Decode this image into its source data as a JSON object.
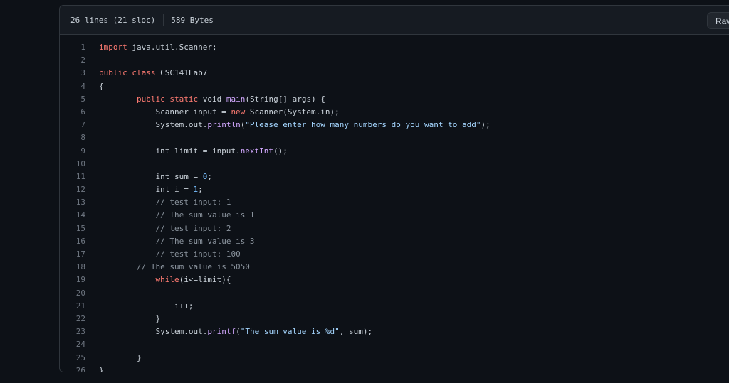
{
  "file_header": {
    "lines_info": "26 lines (21 sloc)",
    "size_info": "589 Bytes",
    "raw_label": "Raw"
  },
  "code_lines": [
    {
      "num": "1",
      "tokens": [
        {
          "t": "import",
          "c": "kw"
        },
        {
          "t": " java.util.Scanner;"
        }
      ]
    },
    {
      "num": "2",
      "tokens": []
    },
    {
      "num": "3",
      "tokens": [
        {
          "t": "public",
          "c": "kw"
        },
        {
          "t": " "
        },
        {
          "t": "class",
          "c": "kw"
        },
        {
          "t": " CSC141Lab7"
        }
      ]
    },
    {
      "num": "4",
      "tokens": [
        {
          "t": "{"
        }
      ]
    },
    {
      "num": "5",
      "tokens": [
        {
          "t": "        "
        },
        {
          "t": "public",
          "c": "kw"
        },
        {
          "t": " "
        },
        {
          "t": "static",
          "c": "kw"
        },
        {
          "t": " void "
        },
        {
          "t": "main",
          "c": "fn"
        },
        {
          "t": "(String[] args) {"
        }
      ]
    },
    {
      "num": "6",
      "tokens": [
        {
          "t": "            Scanner input = "
        },
        {
          "t": "new",
          "c": "kw"
        },
        {
          "t": " Scanner(System.in);"
        }
      ]
    },
    {
      "num": "7",
      "tokens": [
        {
          "t": "            System.out."
        },
        {
          "t": "println",
          "c": "fn"
        },
        {
          "t": "("
        },
        {
          "t": "\"Please enter how many numbers do you want to add\"",
          "c": "str"
        },
        {
          "t": ");"
        }
      ]
    },
    {
      "num": "8",
      "tokens": []
    },
    {
      "num": "9",
      "tokens": [
        {
          "t": "            int limit = input."
        },
        {
          "t": "nextInt",
          "c": "fn"
        },
        {
          "t": "();"
        }
      ]
    },
    {
      "num": "10",
      "tokens": []
    },
    {
      "num": "11",
      "tokens": [
        {
          "t": "            int sum = "
        },
        {
          "t": "0",
          "c": "num"
        },
        {
          "t": ";"
        }
      ]
    },
    {
      "num": "12",
      "tokens": [
        {
          "t": "            int i = "
        },
        {
          "t": "1",
          "c": "num"
        },
        {
          "t": ";"
        }
      ]
    },
    {
      "num": "13",
      "tokens": [
        {
          "t": "            "
        },
        {
          "t": "// test input: 1",
          "c": "cm"
        }
      ]
    },
    {
      "num": "14",
      "tokens": [
        {
          "t": "            "
        },
        {
          "t": "// The sum value is 1",
          "c": "cm"
        }
      ]
    },
    {
      "num": "15",
      "tokens": [
        {
          "t": "            "
        },
        {
          "t": "// test input: 2",
          "c": "cm"
        }
      ]
    },
    {
      "num": "16",
      "tokens": [
        {
          "t": "            "
        },
        {
          "t": "// The sum value is 3",
          "c": "cm"
        }
      ]
    },
    {
      "num": "17",
      "tokens": [
        {
          "t": "            "
        },
        {
          "t": "// test input: 100",
          "c": "cm"
        }
      ]
    },
    {
      "num": "18",
      "tokens": [
        {
          "t": "        "
        },
        {
          "t": "// The sum value is 5050",
          "c": "cm"
        }
      ]
    },
    {
      "num": "19",
      "tokens": [
        {
          "t": "            "
        },
        {
          "t": "while",
          "c": "kw"
        },
        {
          "t": "(i<=limit){"
        }
      ]
    },
    {
      "num": "20",
      "tokens": []
    },
    {
      "num": "21",
      "tokens": [
        {
          "t": "                i++;"
        }
      ]
    },
    {
      "num": "22",
      "tokens": [
        {
          "t": "            }"
        }
      ]
    },
    {
      "num": "23",
      "tokens": [
        {
          "t": "            System.out."
        },
        {
          "t": "printf",
          "c": "fn"
        },
        {
          "t": "("
        },
        {
          "t": "\"The sum value is %d\"",
          "c": "str"
        },
        {
          "t": ", sum);"
        }
      ]
    },
    {
      "num": "24",
      "tokens": []
    },
    {
      "num": "25",
      "tokens": [
        {
          "t": "        }"
        }
      ]
    },
    {
      "num": "26",
      "tokens": [
        {
          "t": "}"
        }
      ]
    }
  ],
  "colors": {
    "keyword": "#ff7b72",
    "function": "#d2a8ff",
    "string": "#a5d6ff",
    "number": "#79c0ff",
    "comment": "#8b949e",
    "text": "#c9d1d9",
    "line_number": "#6e7681",
    "background": "#0d1117"
  }
}
